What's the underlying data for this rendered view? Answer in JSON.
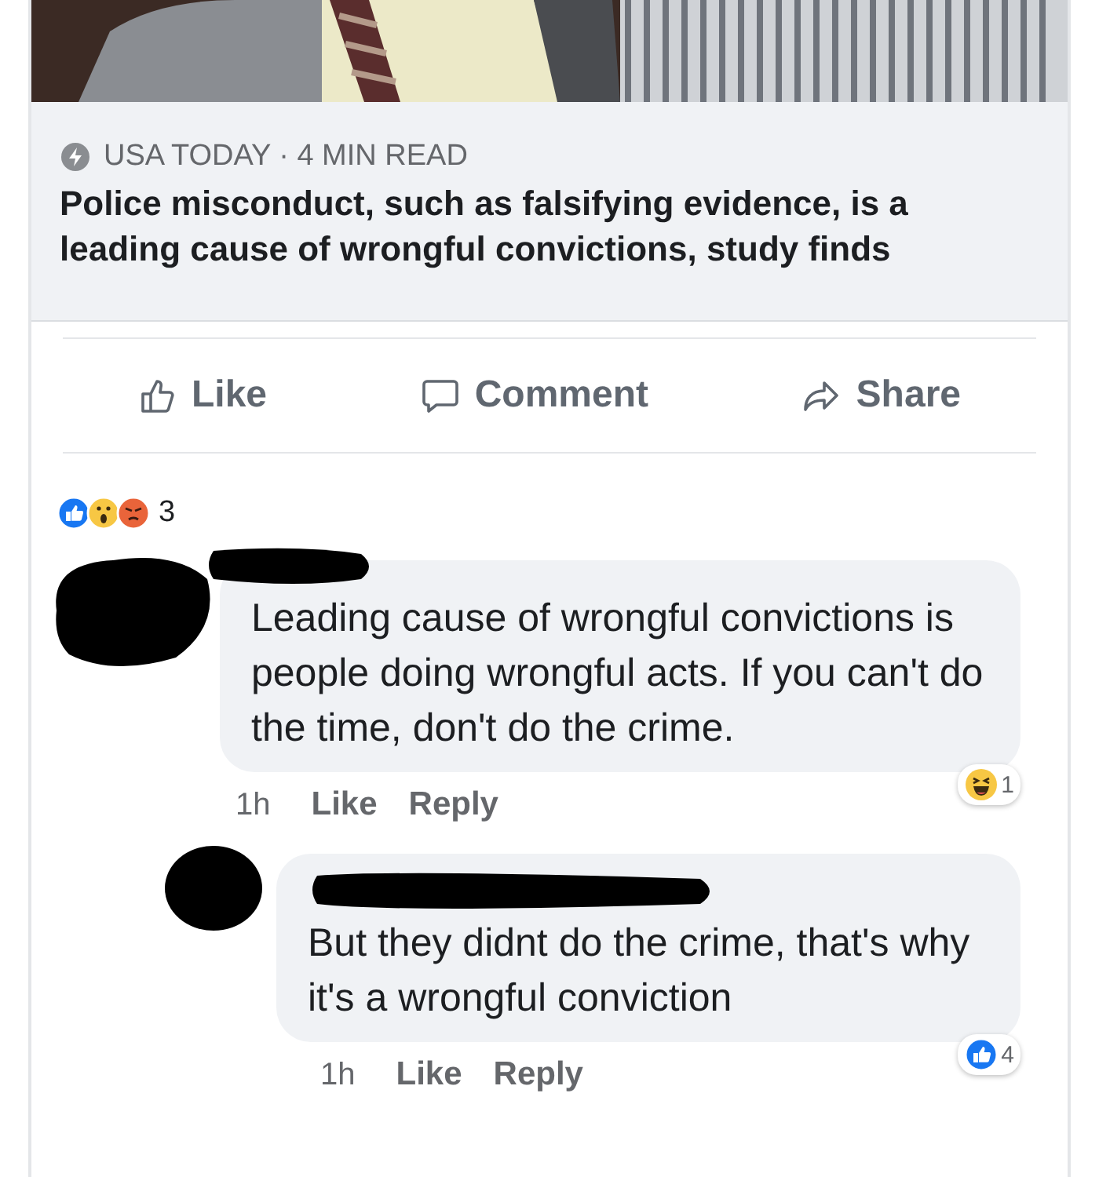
{
  "article": {
    "source": "USA TODAY",
    "separator": "·",
    "read_time": "4 MIN READ",
    "headline": "Police misconduct, such as falsifying evidence, is a leading cause of wrongful convictions, study finds"
  },
  "actions": [
    {
      "kind": "like",
      "label": "Like"
    },
    {
      "kind": "comment",
      "label": "Comment"
    },
    {
      "kind": "share",
      "label": "Share"
    }
  ],
  "reactions": {
    "icons": [
      {
        "kind": "like"
      },
      {
        "kind": "wow"
      },
      {
        "kind": "angry"
      }
    ],
    "count": "3"
  },
  "comments": [
    {
      "reply": false,
      "text": "Leading cause of wrongful convictions is people doing wrongful acts. If you can't do the time, don't do the crime.",
      "time": "1h",
      "actions": [
        "Like",
        "Reply"
      ],
      "reaction": {
        "kind": "haha",
        "count": "1"
      }
    },
    {
      "reply": true,
      "text": "But they didnt do the crime, that's why it's a wrongful conviction",
      "time": "1h",
      "actions": [
        "Like",
        "Reply"
      ],
      "reaction": {
        "kind": "like",
        "count": "4"
      }
    }
  ]
}
